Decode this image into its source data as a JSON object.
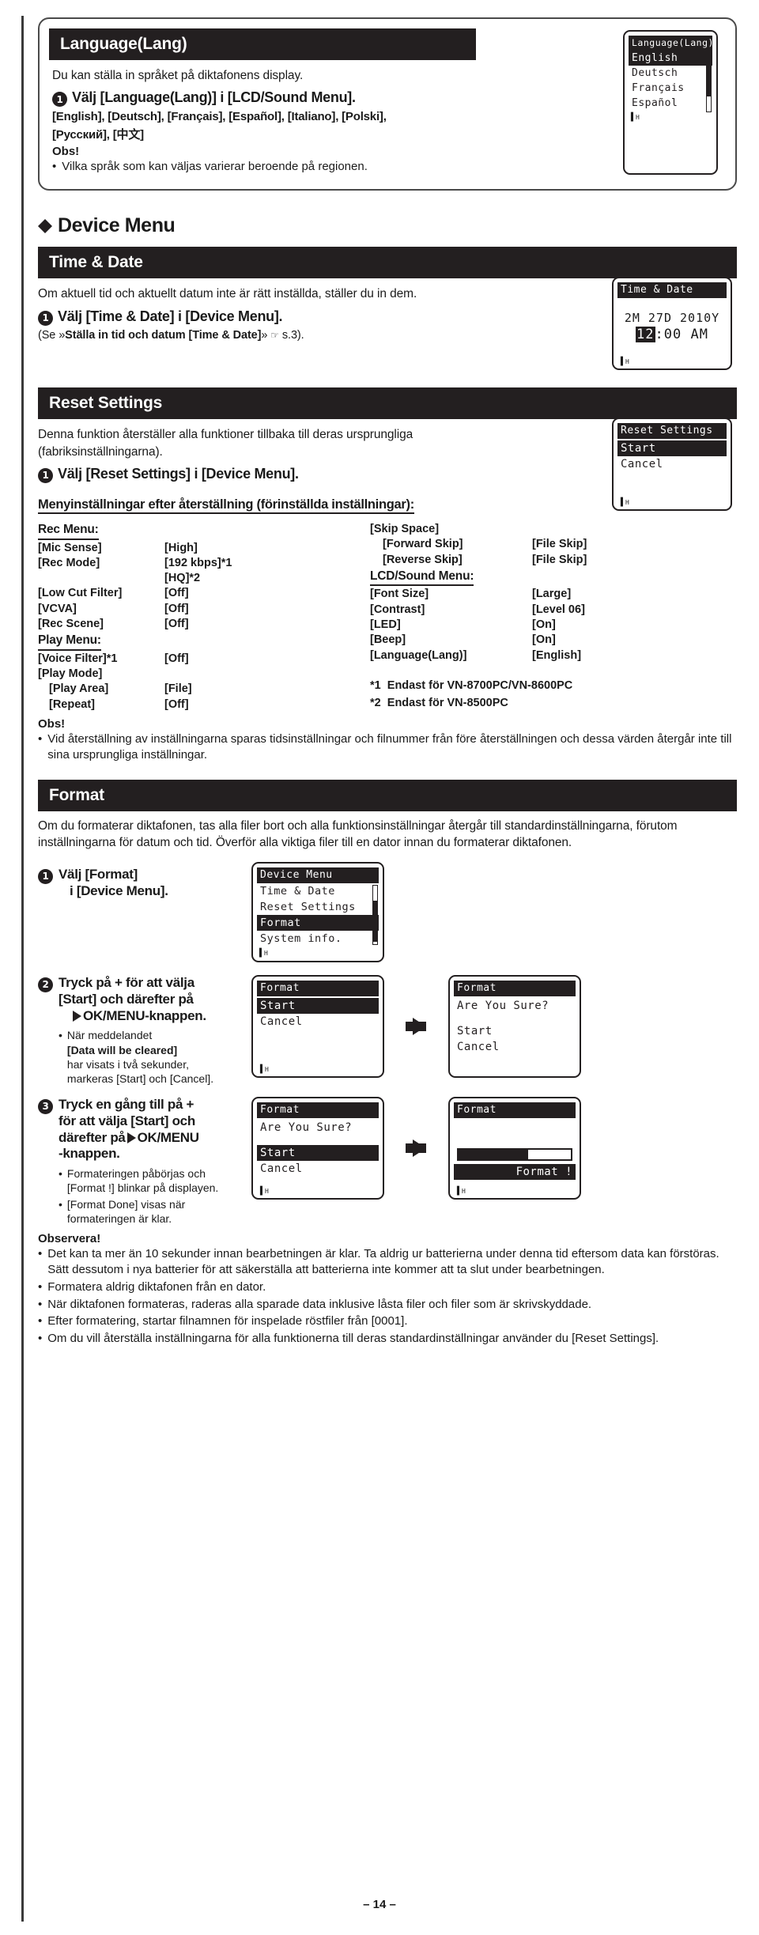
{
  "language_section": {
    "title": "Language(Lang)",
    "intro": "Du kan ställa in språket på diktafonens display.",
    "step1": "Välj [Language(Lang)] i [LCD/Sound Menu].",
    "step_num": "1",
    "lang_list_line1": "[English], [Deutsch], [Français], [Español], [Italiano], [Polski],",
    "lang_list_line2": "[Русский], [中文]",
    "obs_title": "Obs!",
    "obs_bullet": "Vilka språk som kan väljas varierar beroende på regionen.",
    "lcd": {
      "title": "Language(Lang)",
      "rows": [
        "English",
        "Deutsch",
        "Français",
        "Español"
      ],
      "selected_index": 0,
      "footer": "H"
    }
  },
  "device_menu": {
    "heading": "Device Menu"
  },
  "time_date": {
    "title": "Time & Date",
    "intro": "Om aktuell tid och aktuellt datum inte är rätt inställda, ställer du in dem.",
    "step_num": "1",
    "step1": "Välj [Time & Date] i [Device Menu].",
    "ref": "(Se »Ställa in tid och datum [Time & Date]»  s.3).",
    "ref_prefix": "(Se »",
    "ref_bold": "Ställa in tid och datum [Time & Date]",
    "ref_suffix": "»",
    "ref_page": "s.3).",
    "lcd": {
      "title": "Time & Date",
      "date": "2M 27D 2010Y",
      "hour": "12",
      "rest": ":00 AM",
      "footer": "H"
    }
  },
  "reset_settings": {
    "title": "Reset Settings",
    "intro_l1": "Denna funktion återställer alla funktioner tillbaka till deras ursprungliga",
    "intro_l2": "(fabriksinställningarna).",
    "step_num": "1",
    "step1": "Välj [Reset Settings] i [Device Menu].",
    "lcd": {
      "title": "Reset Settings",
      "rows": [
        "Start",
        "Cancel"
      ],
      "selected_index": 0,
      "footer": "H"
    },
    "table_heading": "Menyinställningar efter återställning (förinställda inställningar):",
    "left_groups": [
      {
        "name": "Rec Menu:",
        "rows": [
          {
            "key": "[Mic Sense]",
            "value": "[High]",
            "indent": false
          },
          {
            "key": "[Rec Mode]",
            "value": "[192 kbps]*1",
            "indent": false
          },
          {
            "key": "",
            "value": "[HQ]*2",
            "indent": false
          },
          {
            "key": "[Low Cut Filter]",
            "value": "[Off]",
            "indent": false
          },
          {
            "key": "[VCVA]",
            "value": "[Off]",
            "indent": false
          },
          {
            "key": "[Rec Scene]",
            "value": "[Off]",
            "indent": false
          }
        ]
      },
      {
        "name": "Play Menu:",
        "rows": [
          {
            "key": "[Voice Filter]*1",
            "value": "[Off]",
            "indent": false
          },
          {
            "key": "[Play Mode]",
            "value": "",
            "indent": false
          },
          {
            "key": "[Play Area]",
            "value": "[File]",
            "indent": true
          },
          {
            "key": "[Repeat]",
            "value": "[Off]",
            "indent": true
          }
        ]
      }
    ],
    "right_groups": [
      {
        "name": "",
        "rows": [
          {
            "key": "[Skip Space]",
            "value": "",
            "indent": false
          },
          {
            "key": "[Forward Skip]",
            "value": "[File Skip]",
            "indent": true
          },
          {
            "key": "[Reverse Skip]",
            "value": "[File Skip]",
            "indent": true
          }
        ]
      },
      {
        "name": "LCD/Sound Menu:",
        "rows": [
          {
            "key": "[Font Size]",
            "value": "[Large]",
            "indent": false
          },
          {
            "key": "[Contrast]",
            "value": "[Level 06]",
            "indent": false
          },
          {
            "key": "[LED]",
            "value": "[On]",
            "indent": false
          },
          {
            "key": "[Beep]",
            "value": "[On]",
            "indent": false
          },
          {
            "key": "[Language(Lang)]",
            "value": "[English]",
            "indent": false
          }
        ]
      }
    ],
    "footnote1_mark": "*1",
    "footnote1_text": "Endast för VN-8700PC/VN-8600PC",
    "footnote2_mark": "*2",
    "footnote2_text": "Endast för VN-8500PC",
    "obs_title": "Obs!",
    "obs_l1": "Vid återställning av inställningarna sparas tidsinställningar och filnummer från före",
    "obs_l2": "återställningen och dessa värden återgår inte till sina ursprungliga inställningar."
  },
  "format": {
    "title": "Format",
    "intro_l1": "Om du formaterar diktafonen, tas alla filer bort och alla funktionsinställningar återgår till",
    "intro_l2": "standardinställningarna, förutom inställningarna för datum och tid. Överför alla viktiga filer till en",
    "intro_l3": "dator innan du formaterar diktafonen.",
    "step1_num": "1",
    "step1_l1": "Välj [Format]",
    "step1_l2": "i [Device Menu].",
    "step1_lcd": {
      "title": "Device Menu",
      "rows": [
        "Time & Date",
        "Reset Settings",
        "Format",
        "System info."
      ],
      "selected_index": 2,
      "footer": "H"
    },
    "step2_num": "2",
    "step2_l1": "Tryck på + för att välja",
    "step2_l2": "[Start] och därefter på",
    "step2_l3": "OK/MENU-knappen.",
    "step2_sub_l1": "När meddelandet",
    "step2_sub_l2": "[Data will be cleared]",
    "step2_sub_l3": "har visats i två sekunder,",
    "step2_sub_l4": "markeras [Start] och [Cancel].",
    "step2_lcd_a": {
      "title": "Format",
      "rows": [
        "Start",
        "Cancel"
      ],
      "selected_index": 0,
      "footer": "H"
    },
    "step2_lcd_b": {
      "title": "Format",
      "message": "Are You Sure?",
      "rows": [
        "Start",
        "Cancel"
      ],
      "selected_index": -1,
      "footer": "H"
    },
    "step3_num": "3",
    "step3_l1": "Tryck en gång till på +",
    "step3_l2": "för att välja [Start] och",
    "step3_l3": "därefter på",
    "step3_l3b": "OK/MENU",
    "step3_l4": "-knappen.",
    "step3_sub_l1": "Formateringen påbörjas och",
    "step3_sub_l2": "[Format !] blinkar på displayen.",
    "step3_sub_l3": "[Format Done] visas när",
    "step3_sub_l4": "formateringen är klar.",
    "step3_lcd_a": {
      "title": "Format",
      "message": "Are You Sure?",
      "rows": [
        "Start",
        "Cancel"
      ],
      "selected_index": 0,
      "footer": "H"
    },
    "step3_lcd_b": {
      "title": "Format",
      "progress_percent": 62,
      "status": "Format !",
      "footer": "H"
    },
    "observera_title": "Observera!",
    "observera": [
      "Det kan ta mer än 10 sekunder innan bearbetningen är klar. Ta aldrig ur batterierna under denna tid eftersom data kan förstöras. Sätt dessutom i nya batterier för att säkerställa att batterierna inte kommer att ta slut under bearbetningen.",
      "Formatera aldrig diktafonen från en dator.",
      "När diktafonen formateras, raderas alla sparade data inklusive låsta filer och filer som är skrivskyddade.",
      "Efter formatering, startar filnamnen för inspelade röstfiler från [0001].",
      "Om du vill återställa inställningarna för alla funktionerna till deras standardinställningar använder du [Reset Settings]."
    ]
  },
  "page_number": "– 14 –",
  "colors": {
    "ink": "#231f20",
    "paper": "#ffffff"
  }
}
